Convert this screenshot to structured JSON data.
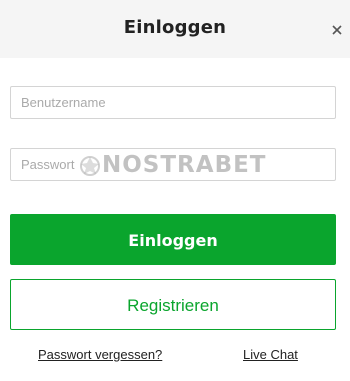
{
  "header": {
    "title": "Einloggen",
    "close_icon": "close-icon"
  },
  "form": {
    "username_placeholder": "Benutzername",
    "password_placeholder": "Passwort",
    "login_label": "Einloggen",
    "register_label": "Registrieren"
  },
  "links": {
    "forgot_password": "Passwort vergessen?",
    "live_chat": "Live Chat"
  },
  "watermark": {
    "text": "NOSTRABET"
  },
  "colors": {
    "accent": "#0aa52d",
    "header_bg": "#f5f5f5",
    "border": "#d4d4d4"
  }
}
